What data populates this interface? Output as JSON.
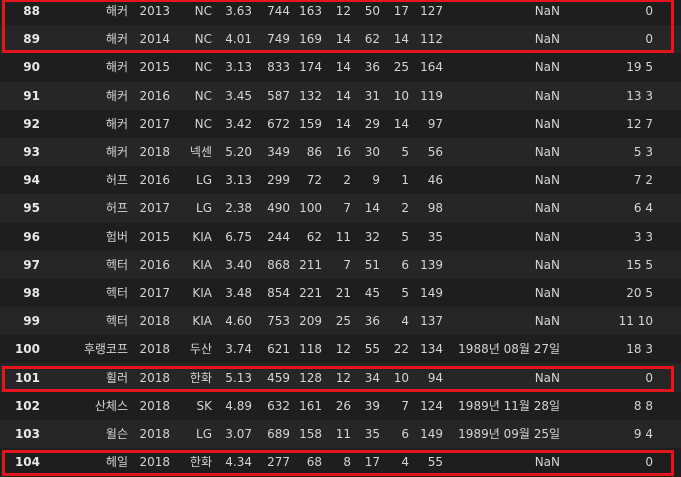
{
  "highlight_color": "#e4151f",
  "rows": [
    {
      "index": "88",
      "name": "해커",
      "year": "2013",
      "team": "NC",
      "era": "3.63",
      "c5": "744",
      "c6": "163",
      "c7": "12",
      "c8": "50",
      "c9": "17",
      "c10": "127",
      "birth": "NaN",
      "last": "0",
      "highlighted": true
    },
    {
      "index": "89",
      "name": "해커",
      "year": "2014",
      "team": "NC",
      "era": "4.01",
      "c5": "749",
      "c6": "169",
      "c7": "14",
      "c8": "62",
      "c9": "14",
      "c10": "112",
      "birth": "NaN",
      "last": "0",
      "highlighted": true
    },
    {
      "index": "90",
      "name": "해커",
      "year": "2015",
      "team": "NC",
      "era": "3.13",
      "c5": "833",
      "c6": "174",
      "c7": "14",
      "c8": "36",
      "c9": "25",
      "c10": "164",
      "birth": "NaN",
      "last": "19 5",
      "highlighted": false
    },
    {
      "index": "91",
      "name": "해커",
      "year": "2016",
      "team": "NC",
      "era": "3.45",
      "c5": "587",
      "c6": "132",
      "c7": "14",
      "c8": "31",
      "c9": "10",
      "c10": "119",
      "birth": "NaN",
      "last": "13 3",
      "highlighted": false
    },
    {
      "index": "92",
      "name": "해커",
      "year": "2017",
      "team": "NC",
      "era": "3.42",
      "c5": "672",
      "c6": "159",
      "c7": "14",
      "c8": "29",
      "c9": "14",
      "c10": "97",
      "birth": "NaN",
      "last": "12 7",
      "highlighted": false
    },
    {
      "index": "93",
      "name": "해커",
      "year": "2018",
      "team": "넥센",
      "era": "5.20",
      "c5": "349",
      "c6": "86",
      "c7": "16",
      "c8": "30",
      "c9": "5",
      "c10": "56",
      "birth": "NaN",
      "last": "5 3",
      "highlighted": false
    },
    {
      "index": "94",
      "name": "허프",
      "year": "2016",
      "team": "LG",
      "era": "3.13",
      "c5": "299",
      "c6": "72",
      "c7": "2",
      "c8": "9",
      "c9": "1",
      "c10": "46",
      "birth": "NaN",
      "last": "7 2",
      "highlighted": false
    },
    {
      "index": "95",
      "name": "허프",
      "year": "2017",
      "team": "LG",
      "era": "2.38",
      "c5": "490",
      "c6": "100",
      "c7": "7",
      "c8": "14",
      "c9": "2",
      "c10": "98",
      "birth": "NaN",
      "last": "6 4",
      "highlighted": false
    },
    {
      "index": "96",
      "name": "험버",
      "year": "2015",
      "team": "KIA",
      "era": "6.75",
      "c5": "244",
      "c6": "62",
      "c7": "11",
      "c8": "32",
      "c9": "5",
      "c10": "35",
      "birth": "NaN",
      "last": "3 3",
      "highlighted": false
    },
    {
      "index": "97",
      "name": "헥터",
      "year": "2016",
      "team": "KIA",
      "era": "3.40",
      "c5": "868",
      "c6": "211",
      "c7": "7",
      "c8": "51",
      "c9": "6",
      "c10": "139",
      "birth": "NaN",
      "last": "15 5",
      "highlighted": false
    },
    {
      "index": "98",
      "name": "헥터",
      "year": "2017",
      "team": "KIA",
      "era": "3.48",
      "c5": "854",
      "c6": "221",
      "c7": "21",
      "c8": "45",
      "c9": "5",
      "c10": "149",
      "birth": "NaN",
      "last": "20 5",
      "highlighted": false
    },
    {
      "index": "99",
      "name": "헥터",
      "year": "2018",
      "team": "KIA",
      "era": "4.60",
      "c5": "753",
      "c6": "209",
      "c7": "25",
      "c8": "36",
      "c9": "4",
      "c10": "137",
      "birth": "NaN",
      "last": "11 10",
      "highlighted": false
    },
    {
      "index": "100",
      "name": "후랭코프",
      "year": "2018",
      "team": "두산",
      "era": "3.74",
      "c5": "621",
      "c6": "118",
      "c7": "12",
      "c8": "55",
      "c9": "22",
      "c10": "134",
      "birth": "1988년 08월 27일",
      "last": "18 3",
      "highlighted": false
    },
    {
      "index": "101",
      "name": "휠러",
      "year": "2018",
      "team": "한화",
      "era": "5.13",
      "c5": "459",
      "c6": "128",
      "c7": "12",
      "c8": "34",
      "c9": "10",
      "c10": "94",
      "birth": "NaN",
      "last": "0",
      "highlighted": true
    },
    {
      "index": "102",
      "name": "산체스",
      "year": "2018",
      "team": "SK",
      "era": "4.89",
      "c5": "632",
      "c6": "161",
      "c7": "26",
      "c8": "39",
      "c9": "7",
      "c10": "124",
      "birth": "1989년 11월 28일",
      "last": "8 8",
      "highlighted": false
    },
    {
      "index": "103",
      "name": "윌슨",
      "year": "2018",
      "team": "LG",
      "era": "3.07",
      "c5": "689",
      "c6": "158",
      "c7": "11",
      "c8": "35",
      "c9": "6",
      "c10": "149",
      "birth": "1989년 09월 25일",
      "last": "9 4",
      "highlighted": false
    },
    {
      "index": "104",
      "name": "헤일",
      "year": "2018",
      "team": "한화",
      "era": "4.34",
      "c5": "277",
      "c6": "68",
      "c7": "8",
      "c8": "17",
      "c9": "4",
      "c10": "55",
      "birth": "NaN",
      "last": "0",
      "highlighted": true
    }
  ]
}
